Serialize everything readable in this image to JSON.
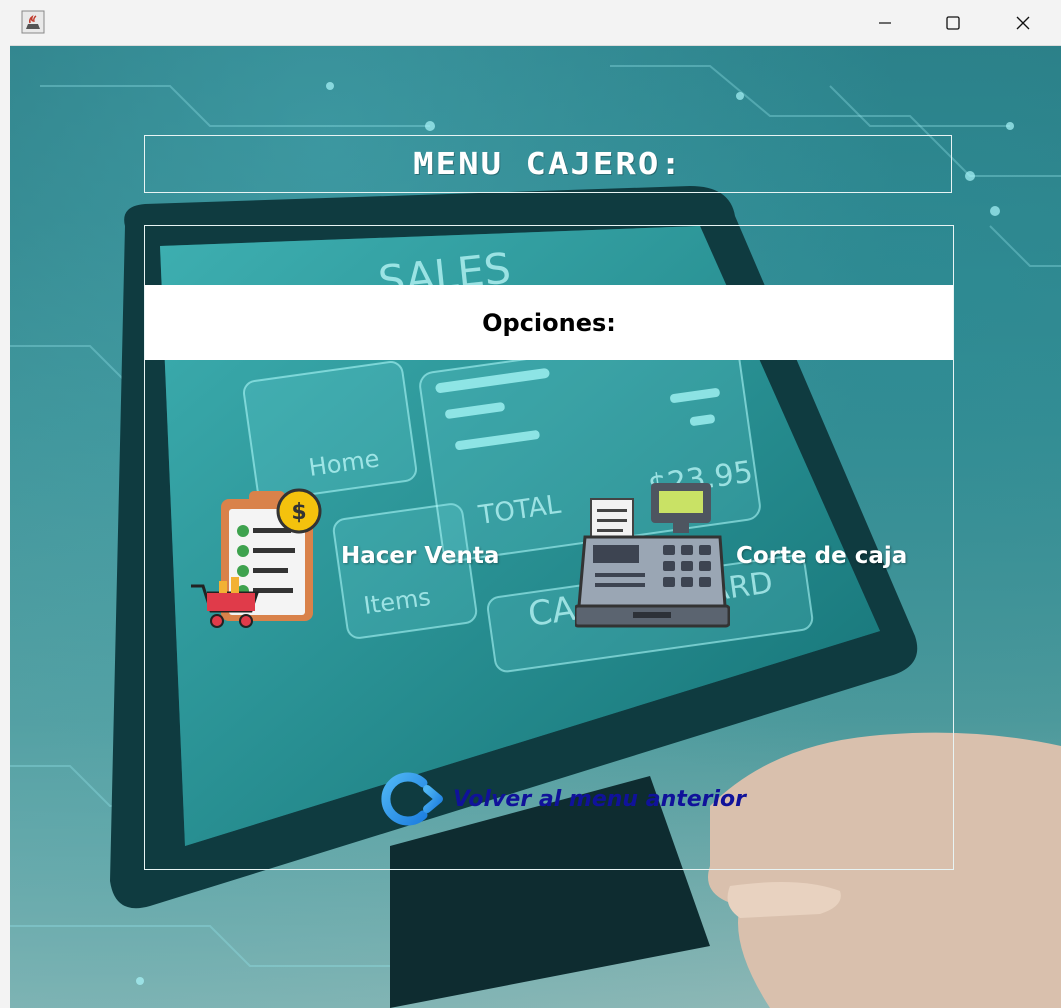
{
  "window": {
    "app_icon": "java-cup-icon",
    "controls": [
      "minimize-icon",
      "maximize-icon",
      "close-icon"
    ]
  },
  "header": {
    "title": "MENU CAJERO:"
  },
  "panel": {
    "options_heading": "Opciones:",
    "options": [
      {
        "label": "Hacer Venta",
        "icon": "sales-checklist-cart-icon"
      },
      {
        "label": "Corte de caja",
        "icon": "cash-register-icon"
      }
    ],
    "back": {
      "label": "Volver al menu anterior",
      "icon": "logout-arrow-icon"
    }
  },
  "colors": {
    "title_bar": "#f3f3f3",
    "options_bar": "#ffffff",
    "back_link": "#10129a",
    "accent_teal": "#2d7c84"
  }
}
